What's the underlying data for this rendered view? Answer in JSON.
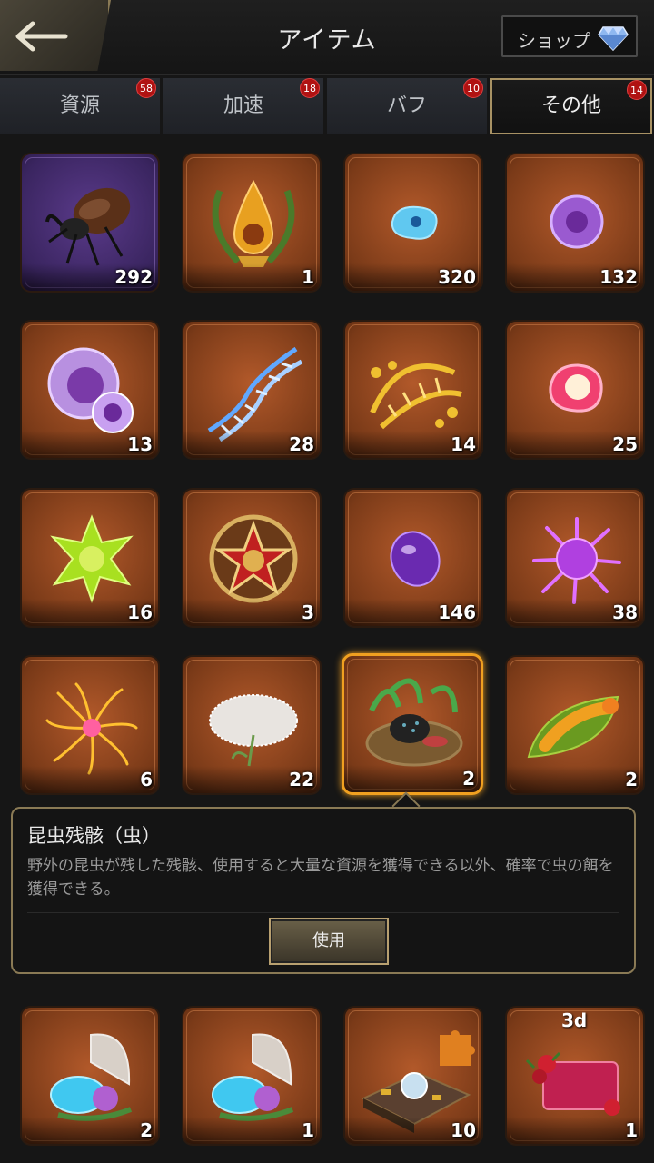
{
  "header": {
    "title": "アイテム",
    "shop_label": "ショップ"
  },
  "tabs": [
    {
      "label": "資源",
      "badge": "58"
    },
    {
      "label": "加速",
      "badge": "18"
    },
    {
      "label": "バフ",
      "badge": "10"
    },
    {
      "label": "その他",
      "badge": "14"
    }
  ],
  "items": [
    {
      "icon": "beetle-icon",
      "qty": "292"
    },
    {
      "icon": "amber-laurel-icon",
      "qty": "1"
    },
    {
      "icon": "blue-cell-icon",
      "qty": "320"
    },
    {
      "icon": "purple-cell-icon",
      "qty": "132"
    },
    {
      "icon": "purple-cells-icon",
      "qty": "13"
    },
    {
      "icon": "blue-dna-icon",
      "qty": "28"
    },
    {
      "icon": "gold-dna-icon",
      "qty": "14"
    },
    {
      "icon": "pink-cell-icon",
      "qty": "25"
    },
    {
      "icon": "green-star-cell-icon",
      "qty": "16"
    },
    {
      "icon": "star-emblem-icon",
      "qty": "3"
    },
    {
      "icon": "purple-drop-icon",
      "qty": "146"
    },
    {
      "icon": "purple-spiky-cell-icon",
      "qty": "38"
    },
    {
      "icon": "golden-flower-icon",
      "qty": "6"
    },
    {
      "icon": "dandelion-icon",
      "qty": "22"
    },
    {
      "icon": "insect-nest-icon",
      "qty": "2"
    },
    {
      "icon": "caterpillar-icon",
      "qty": "2"
    },
    {
      "icon": "shell-cells-icon",
      "qty": "2"
    },
    {
      "icon": "shell-cells-icon",
      "qty": "1"
    },
    {
      "icon": "puzzle-board-icon",
      "qty": "10"
    },
    {
      "icon": "rose-card-icon",
      "qty": "1",
      "tag": "3d"
    }
  ],
  "tooltip": {
    "title": "昆虫残骸（虫）",
    "description": "野外の昆虫が残した残骸、使用すると大量な資源を獲得できる以外、確率で虫の餌を獲得できる。",
    "use_label": "使用"
  }
}
